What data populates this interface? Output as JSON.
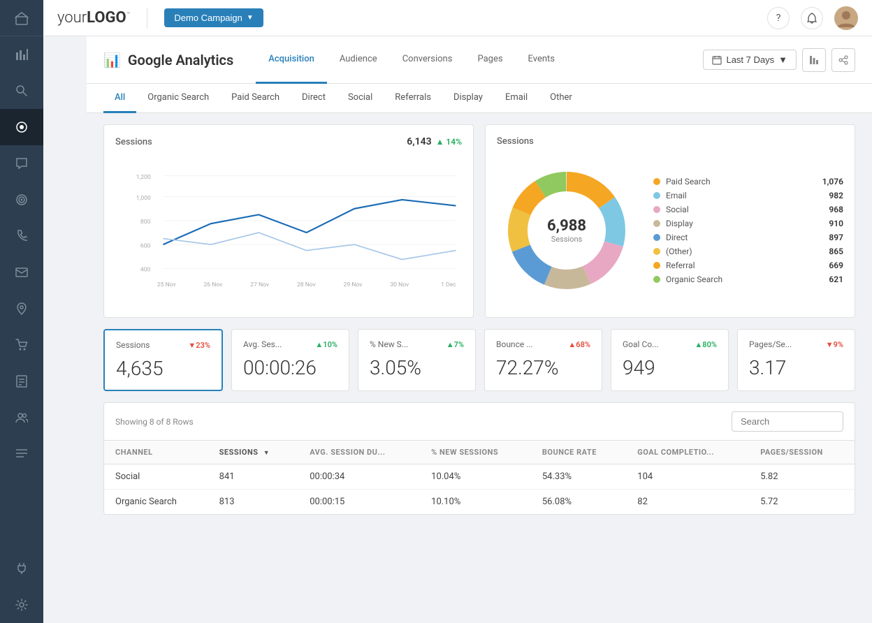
{
  "app": {
    "logo": "your LOGO™",
    "campaign_btn": "Demo Campaign",
    "help_icon": "?",
    "notifications_icon": "🔔"
  },
  "sidebar": {
    "icons": [
      {
        "name": "home-icon",
        "symbol": "⌂"
      },
      {
        "name": "analytics-icon",
        "symbol": "📊"
      },
      {
        "name": "search-icon",
        "symbol": "🔍"
      },
      {
        "name": "activity-icon",
        "symbol": "⬤",
        "active": true
      },
      {
        "name": "chat-icon",
        "symbol": "💬"
      },
      {
        "name": "target-icon",
        "symbol": "◎"
      },
      {
        "name": "phone-icon",
        "symbol": "📞"
      },
      {
        "name": "email-icon",
        "symbol": "✉"
      },
      {
        "name": "location-icon",
        "symbol": "📍"
      },
      {
        "name": "cart-icon",
        "symbol": "🛒"
      },
      {
        "name": "reports-icon",
        "symbol": "📋"
      },
      {
        "name": "users-icon",
        "symbol": "👤"
      },
      {
        "name": "list-icon",
        "symbol": "☰"
      },
      {
        "name": "plug-icon",
        "symbol": "⚡"
      },
      {
        "name": "settings-icon",
        "symbol": "⚙"
      }
    ]
  },
  "page": {
    "icon": "📊",
    "title": "Google Analytics",
    "tabs": [
      {
        "label": "Acquisition",
        "active": true
      },
      {
        "label": "Audience",
        "active": false
      },
      {
        "label": "Conversions",
        "active": false
      },
      {
        "label": "Pages",
        "active": false
      },
      {
        "label": "Events",
        "active": false
      }
    ],
    "date_range": "Last 7 Days"
  },
  "sub_tabs": [
    {
      "label": "All",
      "active": true
    },
    {
      "label": "Organic Search"
    },
    {
      "label": "Paid Search"
    },
    {
      "label": "Direct"
    },
    {
      "label": "Social"
    },
    {
      "label": "Referrals"
    },
    {
      "label": "Display"
    },
    {
      "label": "Email"
    },
    {
      "label": "Other"
    }
  ],
  "line_chart": {
    "title": "Sessions",
    "value": "6,143",
    "trend": "+14%",
    "trend_dir": "up",
    "y_labels": [
      "1,200",
      "1,000",
      "800",
      "600",
      "400"
    ],
    "x_labels": [
      "25 Nov",
      "26 Nov",
      "27 Nov",
      "28 Nov",
      "29 Nov",
      "30 Nov",
      "1 Dec"
    ]
  },
  "donut_chart": {
    "title": "Sessions",
    "total": "6,988",
    "total_label": "Sessions",
    "legend": [
      {
        "name": "Paid Search",
        "value": "1,076",
        "color": "#f5a623"
      },
      {
        "name": "Email",
        "value": "982",
        "color": "#7ec8e3"
      },
      {
        "name": "Social",
        "value": "968",
        "color": "#e8a8c4"
      },
      {
        "name": "Display",
        "value": "910",
        "color": "#c8b89a"
      },
      {
        "name": "Direct",
        "value": "897",
        "color": "#5b9bd5"
      },
      {
        "name": "(Other)",
        "value": "865",
        "color": "#f0c040"
      },
      {
        "name": "Referral",
        "value": "669",
        "color": "#f5a623"
      },
      {
        "name": "Organic Search",
        "value": "621",
        "color": "#90c95f"
      }
    ]
  },
  "metrics": [
    {
      "name": "Sessions",
      "value": "4,635",
      "trend": "▼23%",
      "dir": "down",
      "selected": true
    },
    {
      "name": "Avg. Ses...",
      "value": "00:00:26",
      "trend": "▲10%",
      "dir": "up",
      "selected": false
    },
    {
      "name": "% New S...",
      "value": "3.05%",
      "trend": "▲7%",
      "dir": "up",
      "selected": false
    },
    {
      "name": "Bounce ...",
      "value": "72.27%",
      "trend": "▲68%",
      "dir": "down",
      "selected": false
    },
    {
      "name": "Goal Co...",
      "value": "949",
      "trend": "▲80%",
      "dir": "up",
      "selected": false
    },
    {
      "name": "Pages/Se...",
      "value": "3.17",
      "trend": "▼9%",
      "dir": "down",
      "selected": false
    }
  ],
  "table": {
    "showing_text": "Showing 8 of 8 Rows",
    "search_placeholder": "Search",
    "columns": [
      {
        "label": "CHANNEL",
        "sort": false
      },
      {
        "label": "SESSIONS",
        "sort": true
      },
      {
        "label": "AVG. SESSION DU...",
        "sort": false
      },
      {
        "label": "% NEW SESSIONS",
        "sort": false
      },
      {
        "label": "BOUNCE RATE",
        "sort": false
      },
      {
        "label": "GOAL COMPLETIO...",
        "sort": false
      },
      {
        "label": "PAGES/SESSION",
        "sort": false
      }
    ],
    "rows": [
      {
        "channel": "Social",
        "sessions": "841",
        "avg_dur": "00:00:34",
        "new_sessions": "10.04%",
        "bounce": "54.33%",
        "goal": "104",
        "pages": "5.82"
      },
      {
        "channel": "Organic Search",
        "sessions": "813",
        "avg_dur": "00:00:15",
        "new_sessions": "10.10%",
        "bounce": "56.08%",
        "goal": "82",
        "pages": "5.72"
      }
    ]
  }
}
